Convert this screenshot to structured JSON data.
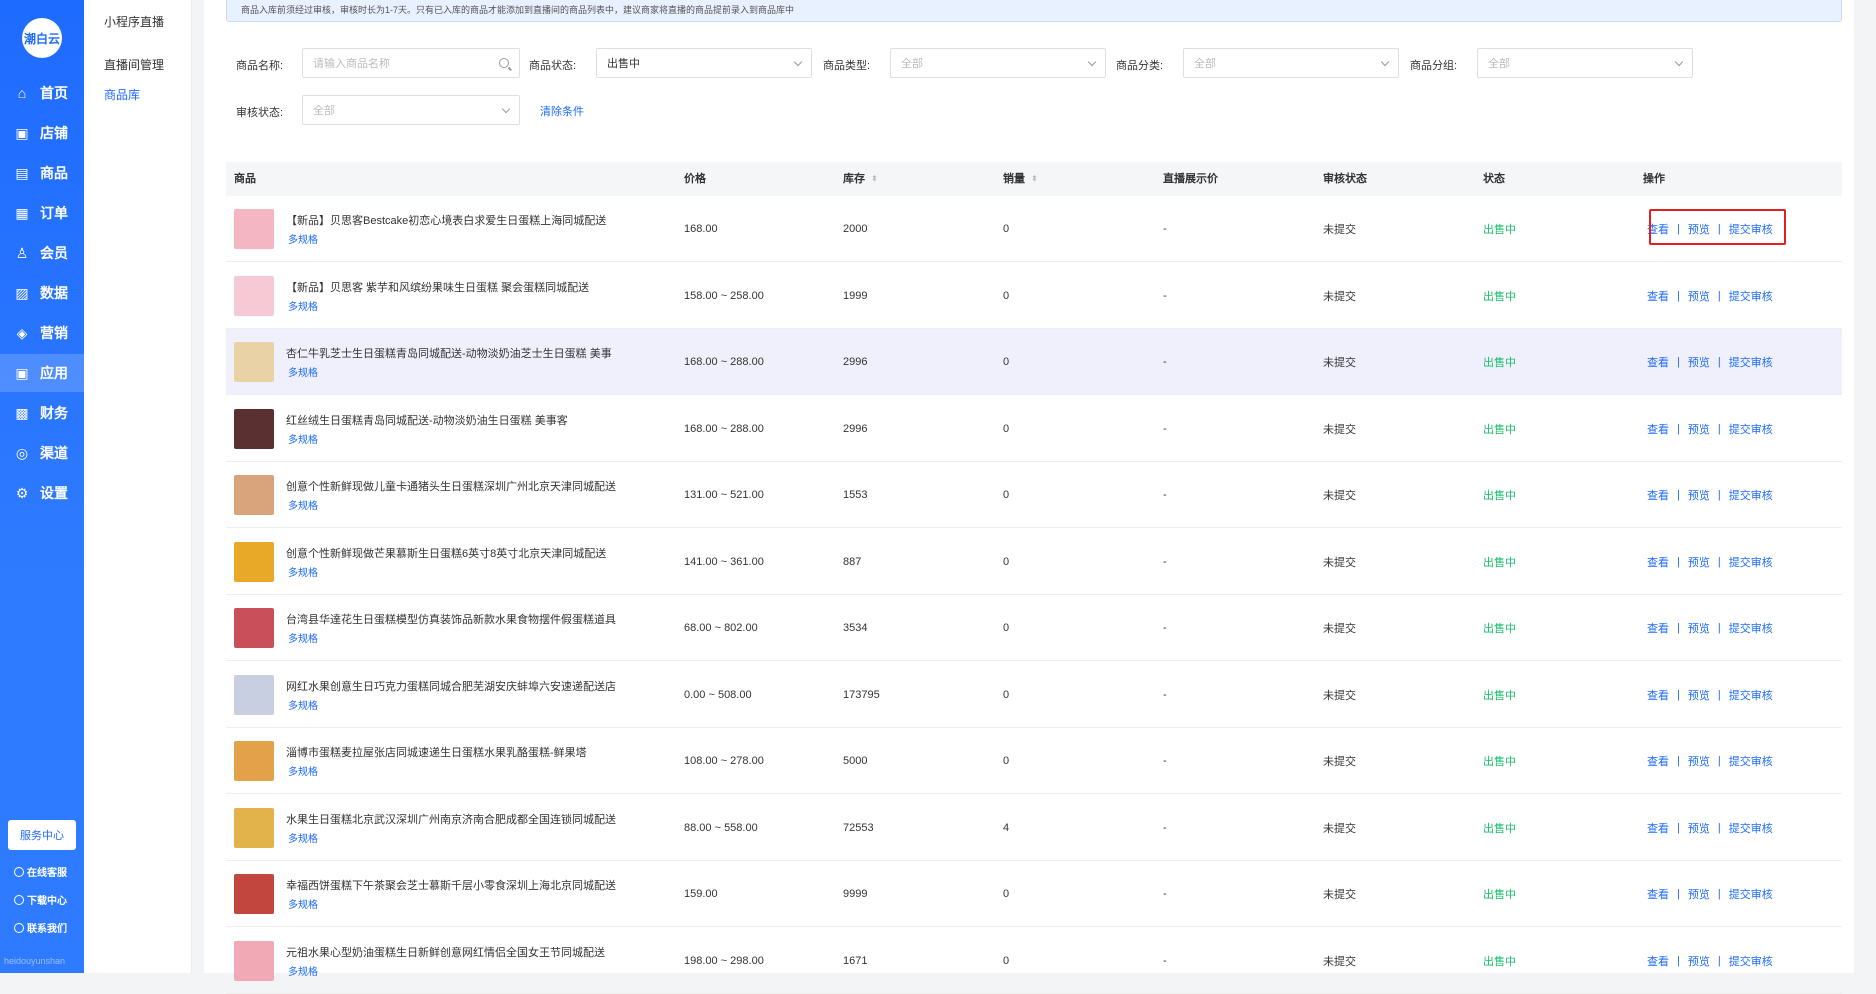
{
  "nav": {
    "logo": "潮白云",
    "items": [
      {
        "label": "首页",
        "icon": "home-icon"
      },
      {
        "label": "店铺",
        "icon": "shop-icon"
      },
      {
        "label": "商品",
        "icon": "goods-icon"
      },
      {
        "label": "订单",
        "icon": "order-icon"
      },
      {
        "label": "会员",
        "icon": "user-icon"
      },
      {
        "label": "数据",
        "icon": "chart-icon"
      },
      {
        "label": "营销",
        "icon": "tag-icon"
      },
      {
        "label": "应用",
        "icon": "app-icon",
        "active": true
      },
      {
        "label": "财务",
        "icon": "finance-icon"
      },
      {
        "label": "渠道",
        "icon": "channel-icon"
      },
      {
        "label": "设置",
        "icon": "gear-icon"
      }
    ],
    "service": "服务中心",
    "online": "在线客服",
    "download": "下载中心",
    "contact": "联系我们",
    "watermark": "heidouyunshan"
  },
  "subnav": {
    "title": "小程序直播",
    "items": [
      {
        "label": "直播间管理"
      },
      {
        "label": "商品库",
        "active": true
      }
    ]
  },
  "notice": "商品入库前须经过审核，审核时长为1-7天。只有已入库的商品才能添加到直播间的商品列表中，建议商家将直播的商品提前录入到商品库中",
  "filters": {
    "name_label": "商品名称:",
    "name_placeholder": "请输入商品名称",
    "state_label": "商品状态:",
    "state_value": "出售中",
    "type_label": "商品类型:",
    "type_value": "全部",
    "category_label": "商品分类:",
    "category_value": "全部",
    "group_label": "商品分组:",
    "group_value": "全部",
    "audit_label": "审核状态:",
    "audit_value": "全部",
    "clear": "清除条件"
  },
  "table": {
    "headers": {
      "product": "商品",
      "price": "价格",
      "stock": "库存",
      "sales": "销量",
      "live_price": "直播展示价",
      "audit": "审核状态",
      "status": "状态",
      "ops": "操作"
    },
    "spec_label": "多规格",
    "op_view": "查看",
    "op_preview": "预览",
    "op_submit": "提交审核",
    "rows": [
      {
        "name": "【新品】贝思客Bestcake初恋心境表白求爱生日蛋糕上海同城配送",
        "price": "168.00",
        "stock": "2000",
        "sales": "0",
        "live": "-",
        "audit": "未提交",
        "status": "出售中",
        "thumb": "#f4b6c2"
      },
      {
        "name": "【新品】贝思客 紫芋和风缤纷果味生日蛋糕 聚会蛋糕同城配送",
        "price": "158.00 ~ 258.00",
        "stock": "1999",
        "sales": "0",
        "live": "-",
        "audit": "未提交",
        "status": "出售中",
        "thumb": "#f7c9d4"
      },
      {
        "name": "杏仁牛乳芝士生日蛋糕青岛同城配送-动物淡奶油芝士生日蛋糕 美事",
        "price": "168.00 ~ 288.00",
        "stock": "2996",
        "sales": "0",
        "live": "-",
        "audit": "未提交",
        "status": "出售中",
        "thumb": "#e8d2a6"
      },
      {
        "name": "红丝绒生日蛋糕青岛同城配送-动物淡奶油生日蛋糕 美事客",
        "price": "168.00 ~ 288.00",
        "stock": "2996",
        "sales": "0",
        "live": "-",
        "audit": "未提交",
        "status": "出售中",
        "thumb": "#5a3030"
      },
      {
        "name": "创意个性新鲜现做儿童卡通猪头生日蛋糕深圳广州北京天津同城配送",
        "price": "131.00 ~ 521.00",
        "stock": "1553",
        "sales": "0",
        "live": "-",
        "audit": "未提交",
        "status": "出售中",
        "thumb": "#d9a47c"
      },
      {
        "name": "创意个性新鲜现做芒果慕斯生日蛋糕6英寸8英寸北京天津同城配送",
        "price": "141.00 ~ 361.00",
        "stock": "887",
        "sales": "0",
        "live": "-",
        "audit": "未提交",
        "status": "出售中",
        "thumb": "#e8a928"
      },
      {
        "name": "台湾县华達花生日蛋糕模型仿真装饰品新款水果食物摆件假蛋糕道具",
        "price": "68.00 ~ 802.00",
        "stock": "3534",
        "sales": "0",
        "live": "-",
        "audit": "未提交",
        "status": "出售中",
        "thumb": "#c9505a"
      },
      {
        "name": "网红水果创意生日巧克力蛋糕同城合肥芜湖安庆蚌埠六安速递配送店",
        "price": "0.00 ~ 508.00",
        "stock": "173795",
        "sales": "0",
        "live": "-",
        "audit": "未提交",
        "status": "出售中",
        "thumb": "#c7cfe0"
      },
      {
        "name": "淄博市蛋糕麦拉屋张店同城速递生日蛋糕水果乳酪蛋糕-鲜果塔",
        "price": "108.00 ~ 278.00",
        "stock": "5000",
        "sales": "0",
        "live": "-",
        "audit": "未提交",
        "status": "出售中",
        "thumb": "#e3a24a"
      },
      {
        "name": "水果生日蛋糕北京武汉深圳广州南京济南合肥成都全国连锁同城配送",
        "price": "88.00 ~ 558.00",
        "stock": "72553",
        "sales": "4",
        "live": "-",
        "audit": "未提交",
        "status": "出售中",
        "thumb": "#e2b34a"
      },
      {
        "name": "幸福西饼蛋糕下午茶聚会芝士慕斯千层小零食深圳上海北京同城配送",
        "price": "159.00",
        "stock": "9999",
        "sales": "0",
        "live": "-",
        "audit": "未提交",
        "status": "出售中",
        "thumb": "#c2463e"
      },
      {
        "name": "元祖水果心型奶油蛋糕生日新鲜创意网红情侣全国女王节同城配送",
        "price": "198.00 ~ 298.00",
        "stock": "1671",
        "sales": "0",
        "live": "-",
        "audit": "未提交",
        "status": "出售中",
        "thumb": "#f2a9b6"
      }
    ]
  }
}
